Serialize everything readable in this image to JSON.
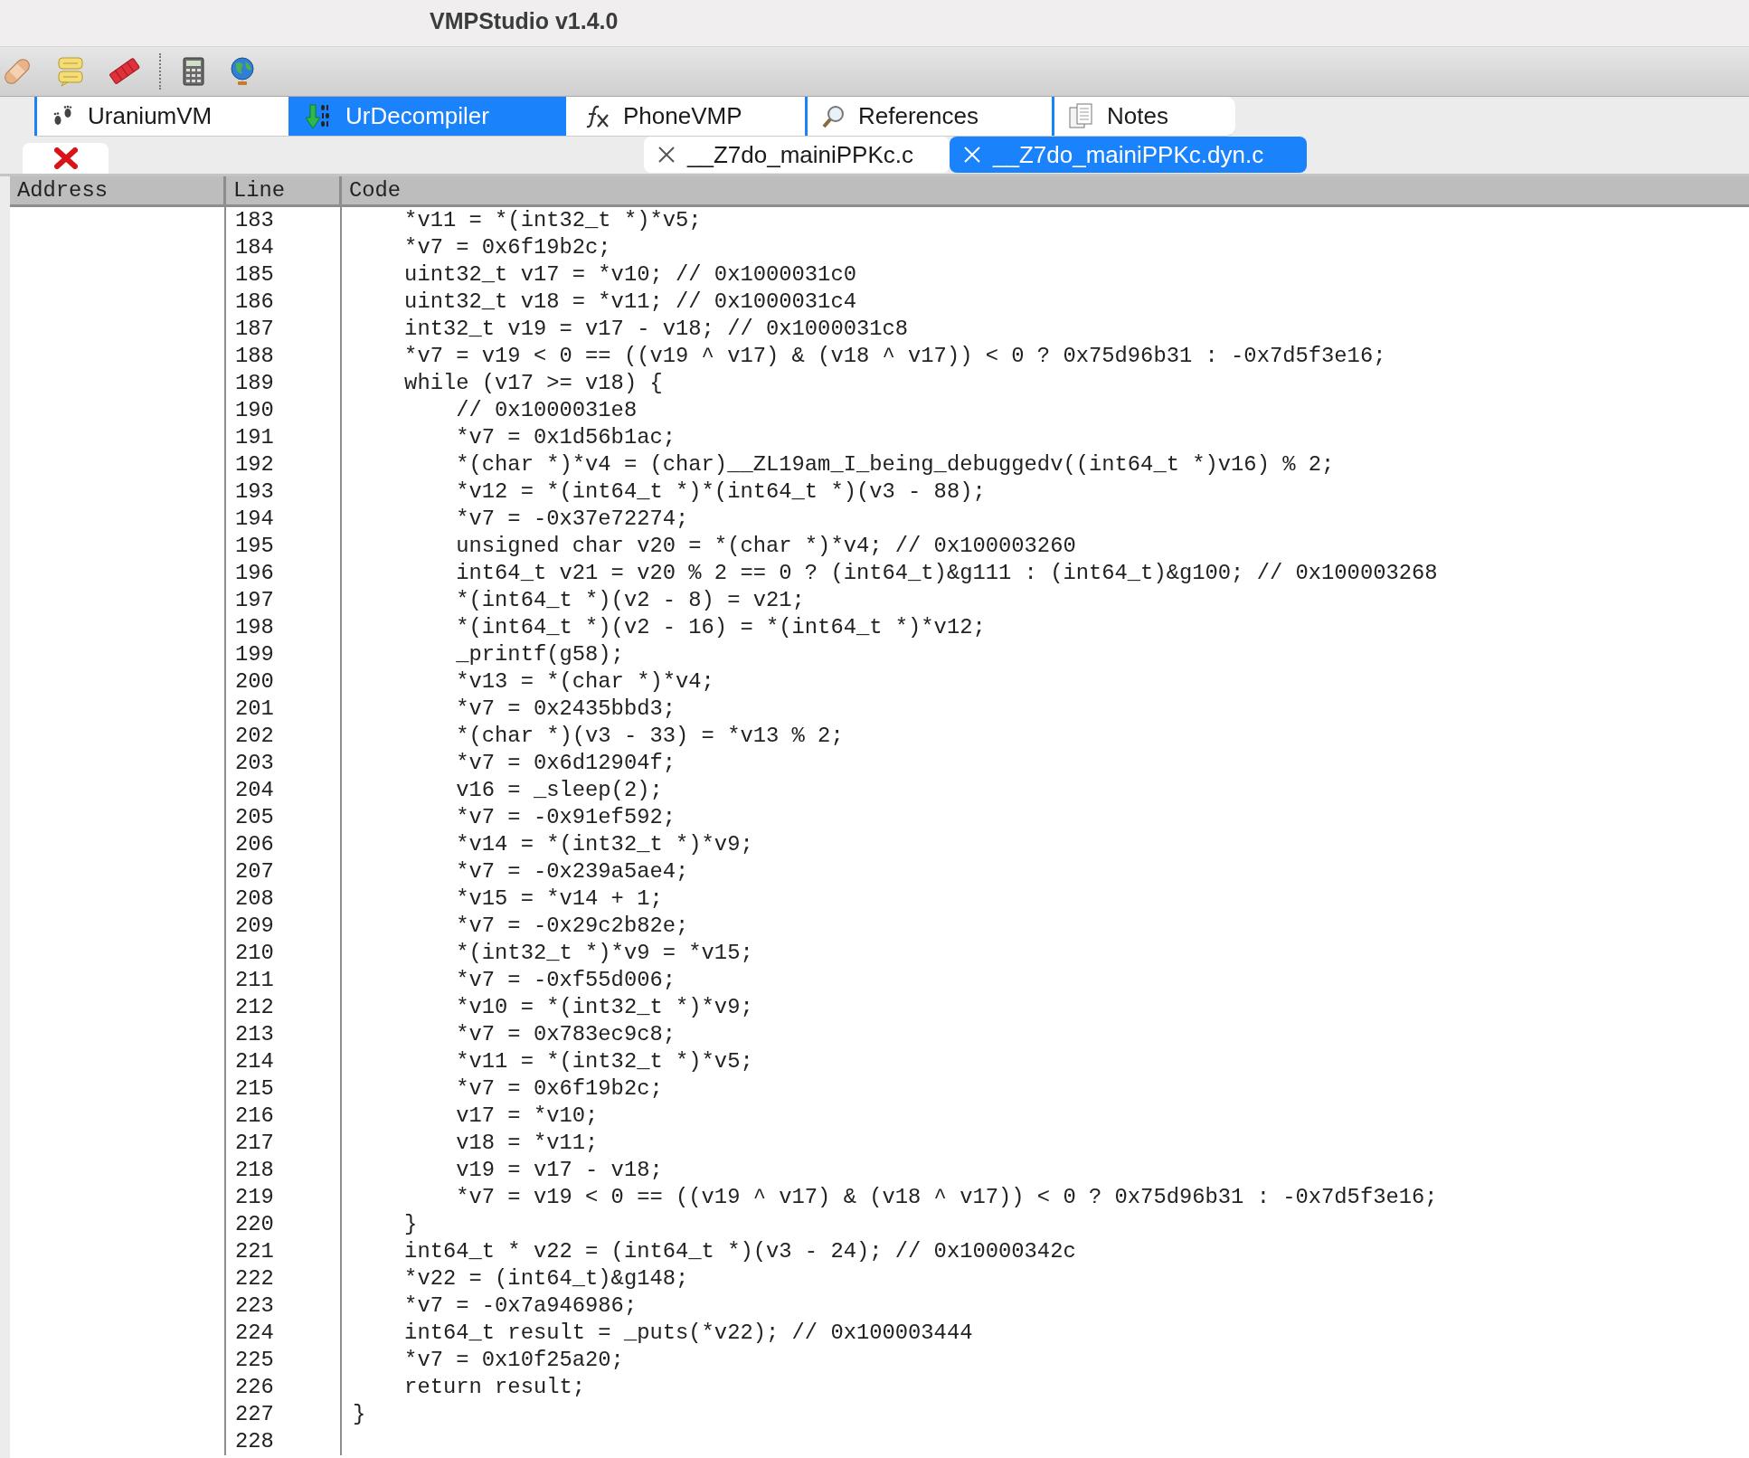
{
  "window": {
    "title": "VMPStudio v1.4.0"
  },
  "tabs": [
    {
      "label": "UraniumVM",
      "selected": false
    },
    {
      "label": "UrDecompiler",
      "selected": true
    },
    {
      "label": "PhoneVMP",
      "selected": false
    },
    {
      "label": "References",
      "selected": false
    },
    {
      "label": "Notes",
      "selected": false
    }
  ],
  "file_tabs": [
    {
      "label": "__Z7do_mainiPPKc.c",
      "selected": false
    },
    {
      "label": "__Z7do_mainiPPKc.dyn.c",
      "selected": true
    }
  ],
  "table": {
    "columns": [
      "Address",
      "Line",
      "Code"
    ],
    "rows": [
      {
        "line": "183",
        "code": "    *v11 = *(int32_t *)*v5;"
      },
      {
        "line": "184",
        "code": "    *v7 = 0x6f19b2c;"
      },
      {
        "line": "185",
        "code": "    uint32_t v17 = *v10; // 0x1000031c0"
      },
      {
        "line": "186",
        "code": "    uint32_t v18 = *v11; // 0x1000031c4"
      },
      {
        "line": "187",
        "code": "    int32_t v19 = v17 - v18; // 0x1000031c8"
      },
      {
        "line": "188",
        "code": "    *v7 = v19 < 0 == ((v19 ^ v17) & (v18 ^ v17)) < 0 ? 0x75d96b31 : -0x7d5f3e16;"
      },
      {
        "line": "189",
        "code": "    while (v17 >= v18) {"
      },
      {
        "line": "190",
        "code": "        // 0x1000031e8"
      },
      {
        "line": "191",
        "code": "        *v7 = 0x1d56b1ac;"
      },
      {
        "line": "192",
        "code": "        *(char *)*v4 = (char)__ZL19am_I_being_debuggedv((int64_t *)v16) % 2;"
      },
      {
        "line": "193",
        "code": "        *v12 = *(int64_t *)*(int64_t *)(v3 - 88);"
      },
      {
        "line": "194",
        "code": "        *v7 = -0x37e72274;"
      },
      {
        "line": "195",
        "code": "        unsigned char v20 = *(char *)*v4; // 0x100003260"
      },
      {
        "line": "196",
        "code": "        int64_t v21 = v20 % 2 == 0 ? (int64_t)&g111 : (int64_t)&g100; // 0x100003268"
      },
      {
        "line": "197",
        "code": "        *(int64_t *)(v2 - 8) = v21;"
      },
      {
        "line": "198",
        "code": "        *(int64_t *)(v2 - 16) = *(int64_t *)*v12;"
      },
      {
        "line": "199",
        "code": "        _printf(g58);"
      },
      {
        "line": "200",
        "code": "        *v13 = *(char *)*v4;"
      },
      {
        "line": "201",
        "code": "        *v7 = 0x2435bbd3;"
      },
      {
        "line": "202",
        "code": "        *(char *)(v3 - 33) = *v13 % 2;"
      },
      {
        "line": "203",
        "code": "        *v7 = 0x6d12904f;"
      },
      {
        "line": "204",
        "code": "        v16 = _sleep(2);"
      },
      {
        "line": "205",
        "code": "        *v7 = -0x91ef592;"
      },
      {
        "line": "206",
        "code": "        *v14 = *(int32_t *)*v9;"
      },
      {
        "line": "207",
        "code": "        *v7 = -0x239a5ae4;"
      },
      {
        "line": "208",
        "code": "        *v15 = *v14 + 1;"
      },
      {
        "line": "209",
        "code": "        *v7 = -0x29c2b82e;"
      },
      {
        "line": "210",
        "code": "        *(int32_t *)*v9 = *v15;"
      },
      {
        "line": "211",
        "code": "        *v7 = -0xf55d006;"
      },
      {
        "line": "212",
        "code": "        *v10 = *(int32_t *)*v9;"
      },
      {
        "line": "213",
        "code": "        *v7 = 0x783ec9c8;"
      },
      {
        "line": "214",
        "code": "        *v11 = *(int32_t *)*v5;"
      },
      {
        "line": "215",
        "code": "        *v7 = 0x6f19b2c;"
      },
      {
        "line": "216",
        "code": "        v17 = *v10;"
      },
      {
        "line": "217",
        "code": "        v18 = *v11;"
      },
      {
        "line": "218",
        "code": "        v19 = v17 - v18;"
      },
      {
        "line": "219",
        "code": "        *v7 = v19 < 0 == ((v19 ^ v17) & (v18 ^ v17)) < 0 ? 0x75d96b31 : -0x7d5f3e16;"
      },
      {
        "line": "220",
        "code": "    }"
      },
      {
        "line": "221",
        "code": "    int64_t * v22 = (int64_t *)(v3 - 24); // 0x10000342c"
      },
      {
        "line": "222",
        "code": "    *v22 = (int64_t)&g148;"
      },
      {
        "line": "223",
        "code": "    *v7 = -0x7a946986;"
      },
      {
        "line": "224",
        "code": "    int64_t result = _puts(*v22); // 0x100003444"
      },
      {
        "line": "225",
        "code": "    *v7 = 0x10f25a20;"
      },
      {
        "line": "226",
        "code": "    return result;"
      },
      {
        "line": "227",
        "code": "}"
      },
      {
        "line": "228",
        "code": ""
      }
    ]
  }
}
